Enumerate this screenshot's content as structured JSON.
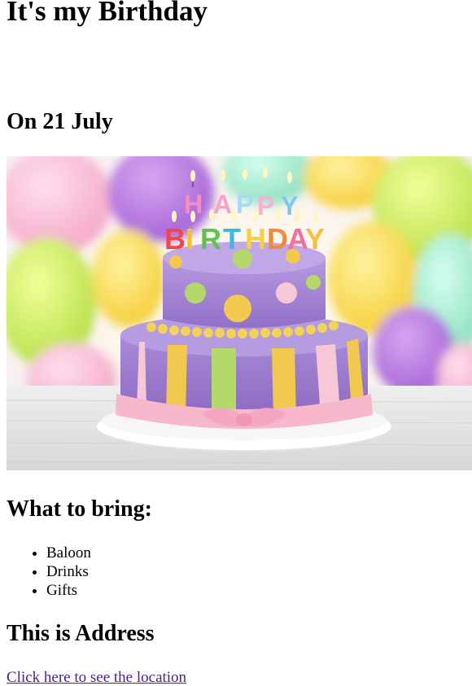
{
  "page": {
    "title": "It's my Birthday",
    "date": "On 21 July"
  },
  "image": {
    "alt": "Birthday cake",
    "candle_letters": [
      "H",
      "A",
      "P",
      "P",
      "Y",
      "B",
      "I",
      "R",
      "T",
      "H",
      "D",
      "A",
      "Y"
    ]
  },
  "bring": {
    "heading": "What to bring:",
    "items": [
      "Baloon",
      "Drinks",
      "Gifts"
    ]
  },
  "address": {
    "heading": "This is Address",
    "link_text": "Click here to see the location"
  },
  "colors": {
    "link_visited": "#551a8b",
    "text": "#000000",
    "background": "#ffffff"
  }
}
